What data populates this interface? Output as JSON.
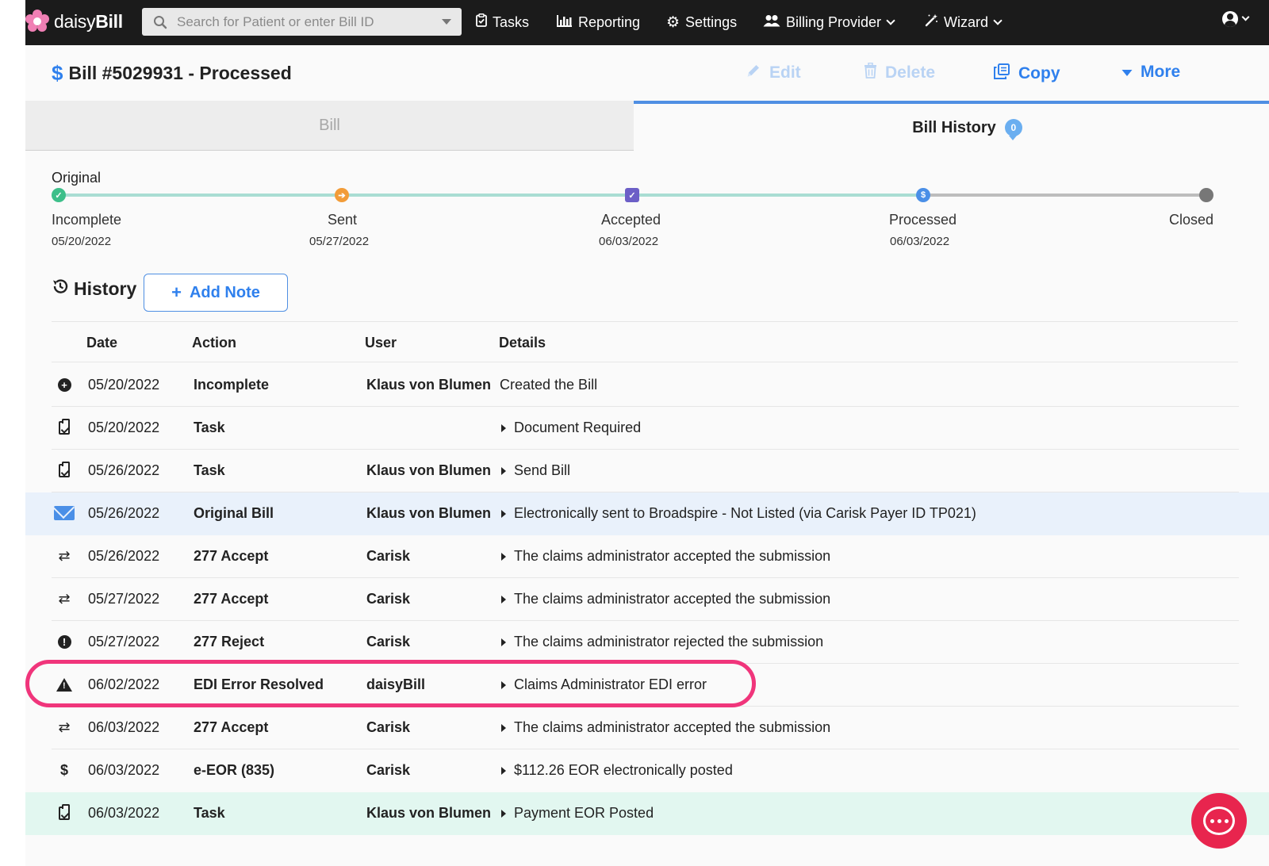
{
  "app": {
    "logo_light": "daisy",
    "logo_bold": "Bill",
    "brand_color": "#f07fb4",
    "accent_color": "#2f80ed"
  },
  "topnav": {
    "search_placeholder": "Search for Patient or enter Bill ID",
    "tasks": "Tasks",
    "reporting": "Reporting",
    "settings": "Settings",
    "billing_provider": "Billing Provider",
    "wizard": "Wizard"
  },
  "bill": {
    "title": "Bill #5029931 - Processed",
    "edit": "Edit",
    "delete": "Delete",
    "copy": "Copy",
    "more": "More"
  },
  "tabs": {
    "bill": "Bill",
    "history": "Bill History",
    "history_badge": "0"
  },
  "progress": {
    "label": "Original",
    "steps": [
      {
        "name": "Incomplete",
        "date": "05/20/2022",
        "color": "#3dbf8a",
        "icon": "check-icon"
      },
      {
        "name": "Sent",
        "date": "05/27/2022",
        "color": "#f29c38",
        "icon": "arrow-right-icon"
      },
      {
        "name": "Accepted",
        "date": "06/03/2022",
        "color": "#6c5fc7",
        "icon": "checkbox-icon"
      },
      {
        "name": "Processed",
        "date": "06/03/2022",
        "color": "#4a8fe7",
        "icon": "dollar-icon"
      },
      {
        "name": "Closed",
        "date": "",
        "color": "#777777",
        "icon": "dot-icon"
      }
    ]
  },
  "history": {
    "title": "History",
    "add_note": "Add Note",
    "columns": {
      "date": "Date",
      "action": "Action",
      "user": "User",
      "details": "Details"
    },
    "rows": [
      {
        "icon": "plus-circle-icon",
        "date": "05/20/2022",
        "action": "Incomplete",
        "user": "Klaus von Blumen",
        "details": "Created the Bill",
        "expandable": false
      },
      {
        "icon": "clipboard-check-icon",
        "date": "05/20/2022",
        "action": "Task",
        "user": "",
        "details": "Document Required",
        "expandable": true
      },
      {
        "icon": "clipboard-check-icon",
        "date": "05/26/2022",
        "action": "Task",
        "user": "Klaus von Blumen",
        "details": "Send Bill",
        "expandable": true
      },
      {
        "icon": "envelope-icon",
        "date": "05/26/2022",
        "action": "Original Bill",
        "user": "Klaus von Blumen",
        "details": "Electronically sent to Broadspire - Not Listed (via Carisk Payer ID TP021)",
        "expandable": true
      },
      {
        "icon": "exchange-icon",
        "date": "05/26/2022",
        "action": "277 Accept",
        "user": "Carisk",
        "details": "The claims administrator accepted the submission",
        "expandable": true
      },
      {
        "icon": "exchange-icon",
        "date": "05/27/2022",
        "action": "277 Accept",
        "user": "Carisk",
        "details": "The claims administrator accepted the submission",
        "expandable": true
      },
      {
        "icon": "exclamation-circle-icon",
        "date": "05/27/2022",
        "action": "277 Reject",
        "user": "Carisk",
        "details": "The claims administrator rejected the submission",
        "expandable": true
      },
      {
        "icon": "warning-triangle-icon",
        "date": "06/02/2022",
        "action": "EDI Error Resolved",
        "user": "daisyBill",
        "details": "Claims Administrator EDI error",
        "expandable": true
      },
      {
        "icon": "exchange-icon",
        "date": "06/03/2022",
        "action": "277 Accept",
        "user": "Carisk",
        "details": "The claims administrator accepted the submission",
        "expandable": true
      },
      {
        "icon": "dollar-icon",
        "date": "06/03/2022",
        "action": "e-EOR (835)",
        "user": "Carisk",
        "details": "$112.26 EOR electronically posted",
        "expandable": true
      },
      {
        "icon": "clipboard-check-icon",
        "date": "06/03/2022",
        "action": "Task",
        "user": "Klaus von Blumen",
        "details": "Payment EOR Posted",
        "expandable": true
      }
    ]
  }
}
